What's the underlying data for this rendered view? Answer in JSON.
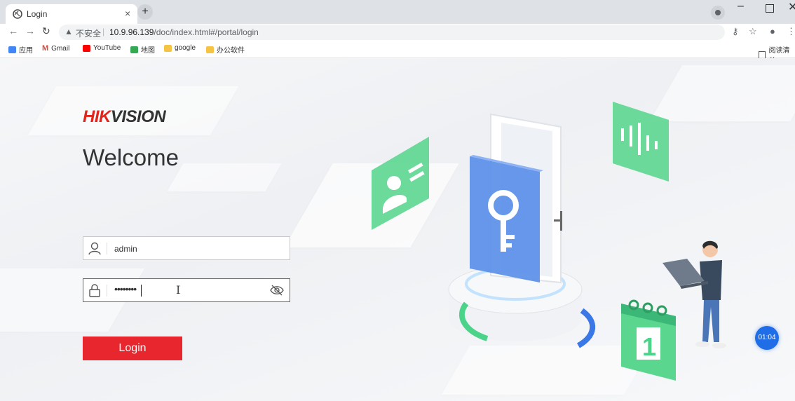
{
  "browser": {
    "tab_title": "Login",
    "tab_close": "×",
    "new_tab": "+",
    "insecure_label": "不安全",
    "url_host": "10.9.96.139",
    "url_path": "/doc/index.html#/portal/login",
    "window_min": "–",
    "window_close": "✕"
  },
  "bookmarks": [
    {
      "label": "应用",
      "color": "#4285f4"
    },
    {
      "label": "Gmail",
      "color": "#ea4335"
    },
    {
      "label": "YouTube",
      "color": "#ff0000"
    },
    {
      "label": "地图",
      "color": "#34a853"
    },
    {
      "label": "google",
      "color": "#f6c445"
    },
    {
      "label": "办公软件",
      "color": "#f6c445"
    }
  ],
  "reading_list": "阅读清单",
  "page": {
    "brand_highlight": "HIK",
    "brand_rest": "VISION",
    "welcome": "Welcome",
    "username_value": "admin",
    "password_mask": "••••••••",
    "login_label": "Login",
    "timer": "01:04"
  },
  "colors": {
    "brand_red": "#e1251b",
    "button_red": "#e8262e",
    "accent_green": "#4cd38a",
    "accent_blue": "#3b78e7"
  }
}
